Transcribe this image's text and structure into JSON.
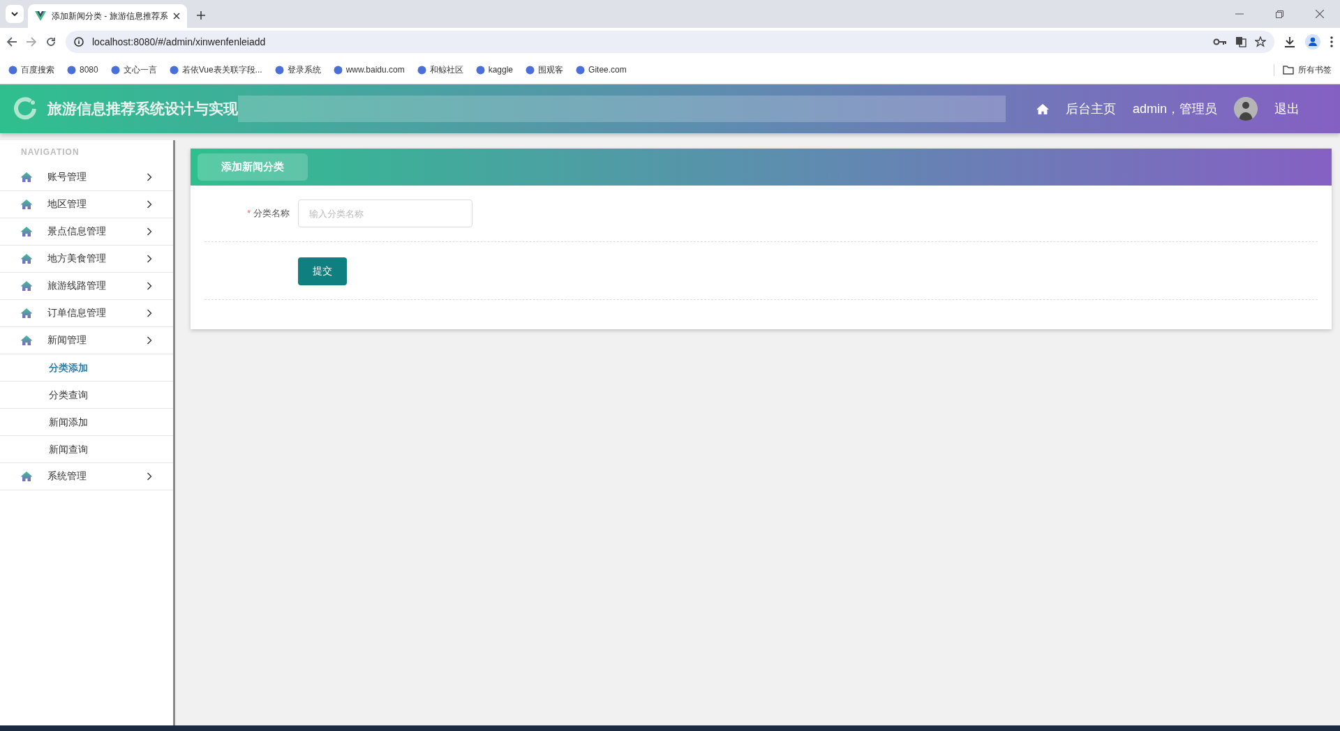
{
  "browser": {
    "tab_title": "添加新闻分类 - 旅游信息推荐系",
    "url": "localhost:8080/#/admin/xinwenfenleiadd",
    "bookmarks": [
      "百度搜索",
      "8080",
      "文心一言",
      "若依Vue表关联字段...",
      "登录系统",
      "www.baidu.com",
      "和鲸社区",
      "kaggle",
      "围观客",
      "Gitee.com"
    ],
    "all_bookmarks": "所有书签"
  },
  "header": {
    "title": "旅游信息推荐系统设计与实现",
    "home_link": "后台主页",
    "user": "admin，管理员",
    "logout": "退出"
  },
  "sidebar": {
    "heading": "NAVIGATION",
    "items": [
      {
        "label": "账号管理"
      },
      {
        "label": "地区管理"
      },
      {
        "label": "景点信息管理"
      },
      {
        "label": "地方美食管理"
      },
      {
        "label": "旅游线路管理"
      },
      {
        "label": "订单信息管理"
      },
      {
        "label": "新闻管理",
        "children": [
          {
            "label": "分类添加",
            "selected": true
          },
          {
            "label": "分类查询",
            "selected": false
          },
          {
            "label": "新闻添加",
            "selected": false
          },
          {
            "label": "新闻查询",
            "selected": false
          }
        ]
      },
      {
        "label": "系统管理"
      }
    ]
  },
  "form": {
    "title": "添加新闻分类",
    "fields": [
      {
        "label": "分类名称",
        "required_mark": "*",
        "placeholder": "输入分类名称"
      }
    ],
    "submit": "提交"
  }
}
